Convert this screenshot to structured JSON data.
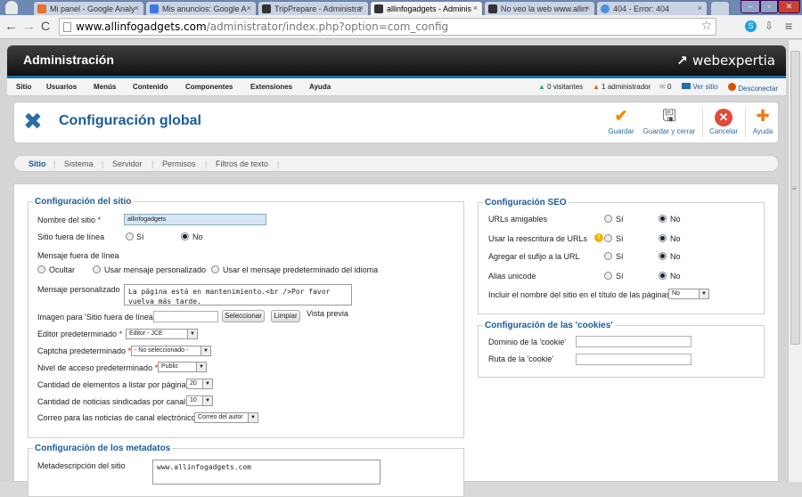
{
  "browser": {
    "tabs": [
      {
        "label": "Mi panel - Google Analy",
        "color": "#e8722c"
      },
      {
        "label": "Mis anuncios: Google A",
        "color": "#3b78e7"
      },
      {
        "label": "TripPrepare - Administra",
        "color": "#333333"
      },
      {
        "label": "allinfogadgets - Adminis",
        "color": "#333333"
      },
      {
        "label": "No veo la web www.allin",
        "color": "#333333"
      },
      {
        "label": "404 - Error: 404",
        "color": "#4a90d9"
      }
    ],
    "tab_close": "×",
    "url_host": "www.allinfogadgets.com",
    "url_rest": "/administrator/index.php?option=com_config"
  },
  "header": {
    "title": "Administración",
    "logo": "webexpertia"
  },
  "menu": {
    "items": [
      "Sitio",
      "Usuarios",
      "Menús",
      "Contenido",
      "Componentes",
      "Extensiones",
      "Ayuda"
    ],
    "status": {
      "visitors": "0 visitantes",
      "admins": "1 administrador",
      "messages": "0",
      "view_site": "Ver sitio",
      "logout": "Desconectar"
    }
  },
  "toolbar": {
    "title": "Configuración global",
    "save": "Guardar",
    "save_close": "Guardar y cerrar",
    "cancel": "Cancelar",
    "help": "Ayuda"
  },
  "subnav": [
    "Sitio",
    "Sistema",
    "Servidor",
    "Permisos",
    "Filtros de texto"
  ],
  "site": {
    "legend": "Configuración del sitio",
    "site_name_label": "Nombre del sitio",
    "site_name_value": "allinfogadgets",
    "offline_label": "Sitio fuera de línea",
    "yes": "Sí",
    "no": "No",
    "offline_msg_label": "Mensaje fuera de línea",
    "opt_hide": "Ocultar",
    "opt_custom": "Usar mensaje personalizado",
    "opt_default": "Usar el mensaje predeterminado del idioma",
    "custom_msg_label": "Mensaje personalizado",
    "custom_msg_value": "La página está en mantenimiento.<br />Por favor vuelva más tarde.",
    "offline_image_label": "Imagen para 'Sitio fuera de línea'",
    "select_btn": "Seleccionar",
    "clear_btn": "Limpiar",
    "preview": "Vista previa",
    "editor_label": "Editor predeterminado",
    "editor_value": "Editor - JCE",
    "captcha_label": "Captcha predeterminado",
    "captcha_value": "- No seleccionado -",
    "access_label": "Nivel de acceso predeterminado",
    "access_value": "Public",
    "list_label": "Cantidad de elementos a listar por página",
    "list_value": "20",
    "feed_label": "Cantidad de noticias sindicadas por canal",
    "feed_value": "10",
    "email_label": "Correo para las noticias de canal electrónico",
    "email_value": "Correo del autor"
  },
  "meta": {
    "legend": "Configuración de los metadatos",
    "desc_label": "Metadescripción del sitio",
    "desc_value": "www.allinfogadgets.com"
  },
  "seo": {
    "legend": "Configuración SEO",
    "sef_label": "URLs amigables",
    "rewrite_label": "Usar la reescritura de URLs",
    "suffix_label": "Agregar el sufijo a la URL",
    "unicode_label": "Alias unicode",
    "sitename_label": "Incluir el nombre del sitio en el título de las páginas",
    "sitename_value": "No"
  },
  "cookies": {
    "legend": "Configuración de las 'cookies'",
    "domain_label": "Dominio de la 'cookie'",
    "path_label": "Ruta de la 'cookie'"
  },
  "colors": {
    "accent": "#1b5c96",
    "header": "#1e6fa8"
  }
}
